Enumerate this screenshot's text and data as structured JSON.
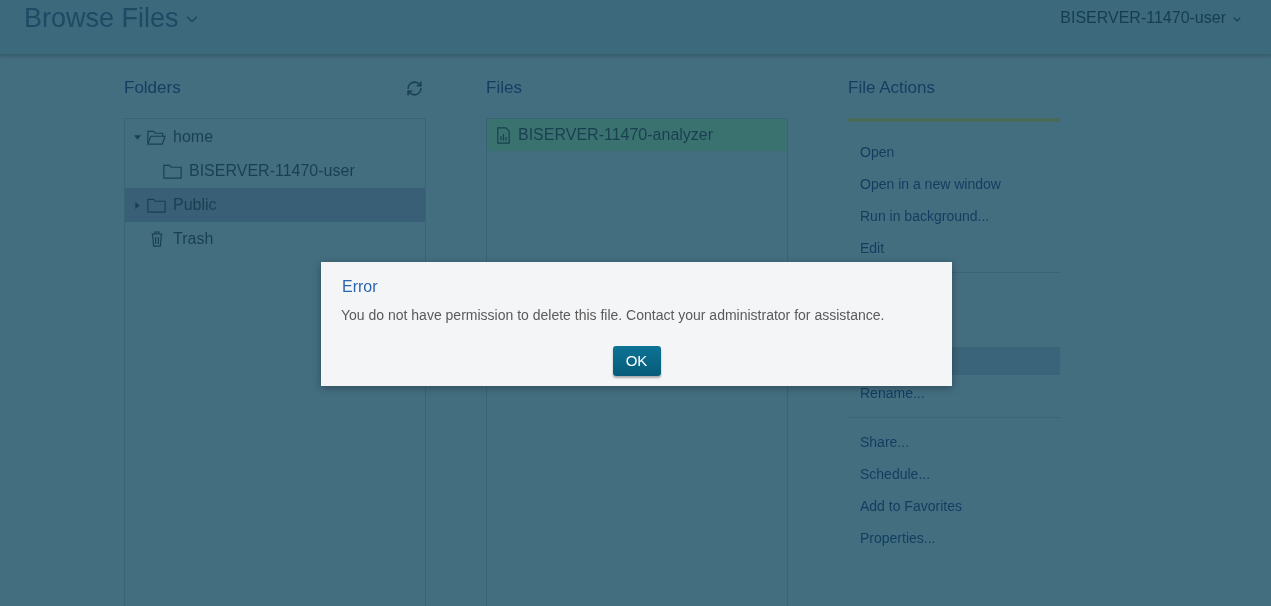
{
  "header": {
    "title": "Browse Files",
    "user_menu": "BISERVER-11470-user"
  },
  "folders": {
    "title": "Folders",
    "tree": [
      {
        "label": "home",
        "kind": "folder",
        "expanded": true,
        "selected": false,
        "children": [
          {
            "label": "BISERVER-11470-user",
            "kind": "folder",
            "selected": false
          }
        ]
      },
      {
        "label": "Public",
        "kind": "folder",
        "expanded": false,
        "selected": true
      },
      {
        "label": "Trash",
        "kind": "trash",
        "selected": false
      }
    ]
  },
  "files": {
    "title": "Files",
    "items": [
      {
        "label": "BISERVER-11470-analyzer",
        "selected": true
      }
    ]
  },
  "file_actions": {
    "title": "File Actions",
    "groups": [
      {
        "items": [
          {
            "label": "Open"
          },
          {
            "label": "Open in a new window"
          },
          {
            "label": "Run in background..."
          },
          {
            "label": "Edit"
          }
        ]
      },
      {
        "hidden_row_highlighted": true,
        "items": [
          {
            "label": "Rename..."
          }
        ]
      },
      {
        "items": [
          {
            "label": "Share..."
          },
          {
            "label": "Schedule..."
          },
          {
            "label": "Add to Favorites"
          },
          {
            "label": "Properties..."
          }
        ]
      }
    ]
  },
  "dialog": {
    "title": "Error",
    "message": "You do not have permission to delete this file. Contact your administrator for assistance.",
    "button": "OK"
  }
}
